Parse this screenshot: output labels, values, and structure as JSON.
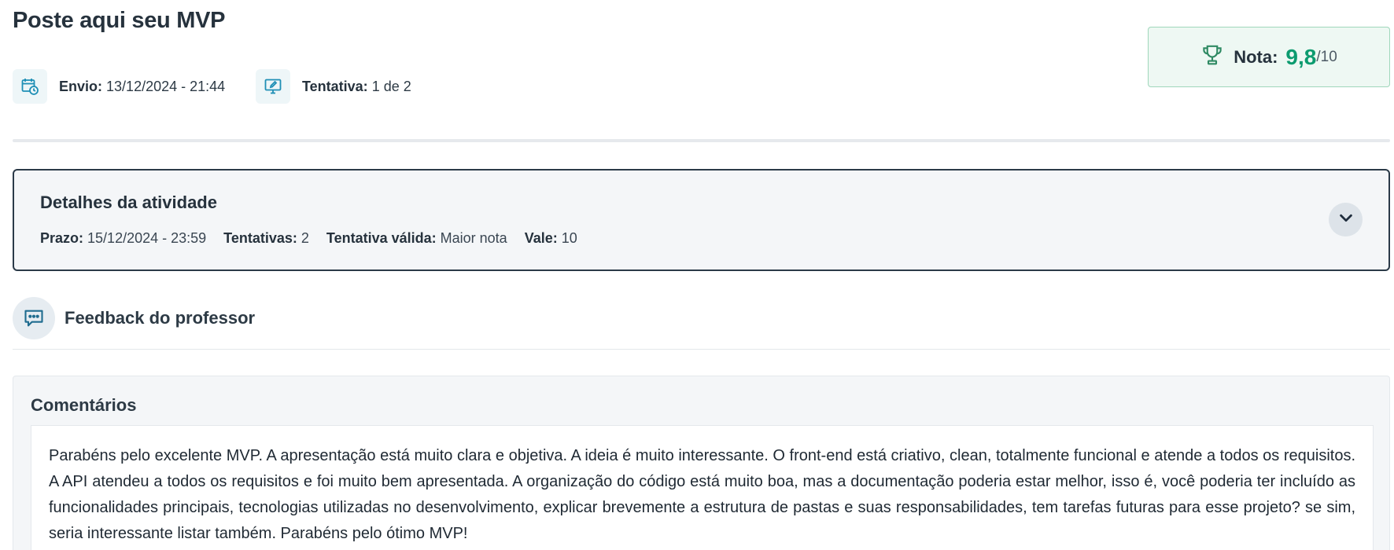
{
  "page": {
    "title": "Poste aqui seu MVP"
  },
  "submission": {
    "sent_label": "Envio:",
    "sent_value": "13/12/2024 - 21:44",
    "attempt_label": "Tentativa:",
    "attempt_value": "1 de 2"
  },
  "grade": {
    "label": "Nota:",
    "value": "9,8",
    "max": "/10"
  },
  "details": {
    "title": "Detalhes da atividade",
    "deadline_label": "Prazo:",
    "deadline_value": "15/12/2024 - 23:59",
    "attempts_label": "Tentativas:",
    "attempts_value": "2",
    "valid_attempt_label": "Tentativa válida:",
    "valid_attempt_value": "Maior nota",
    "worth_label": "Vale:",
    "worth_value": "10"
  },
  "feedback": {
    "title": "Feedback do professor"
  },
  "comments": {
    "title": "Comentários",
    "text": "Parabéns pelo excelente MVP. A apresentação está muito clara e objetiva. A ideia é muito interessante. O front-end está criativo, clean, totalmente funcional e atende a todos os requisitos. A API atendeu a todos os requisitos e foi muito bem apresentada. A organização do código está muito boa, mas a documentação poderia estar melhor, isso é, você poderia ter incluído as funcionalidades principais, tecnologias utilizadas no desenvolvimento, explicar brevemente a estrutura de pastas e suas responsabilidades, tem tarefas futuras para esse projeto? se sim, seria interessante listar também. Parabéns pelo ótimo MVP!"
  },
  "icons": {
    "calendar": "calendar-clock-icon",
    "attempt": "monitor-edit-icon",
    "trophy": "trophy-icon",
    "chevron": "chevron-down-icon",
    "feedback": "chat-bubble-icon"
  },
  "colors": {
    "accent_teal": "#1f8fb5",
    "grade_green": "#0c9b6f",
    "grade_bg": "#eef8f3",
    "card_border": "#2b3a48"
  }
}
